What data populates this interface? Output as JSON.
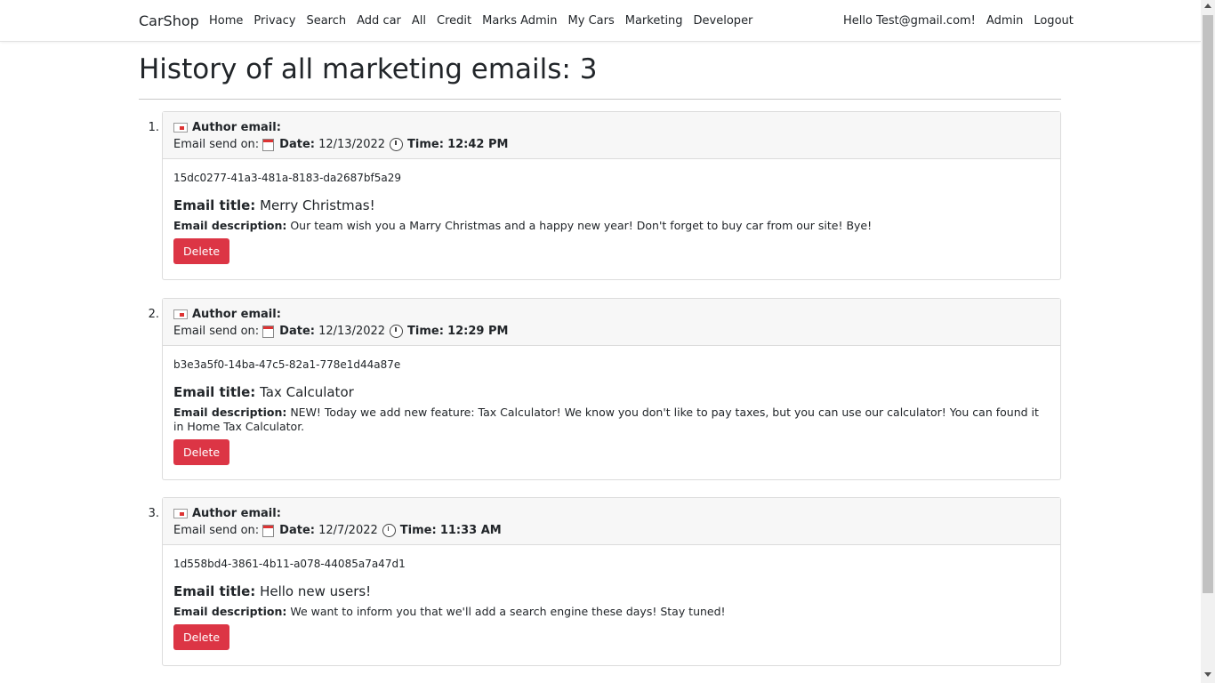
{
  "nav": {
    "brand": "CarShop",
    "links": [
      "Home",
      "Privacy",
      "Search",
      "Add car",
      "All",
      "Credit",
      "Marks Admin",
      "My Cars",
      "Marketing",
      "Developer"
    ],
    "greeting": "Hello Test@gmail.com!",
    "admin": "Admin",
    "logout": "Logout"
  },
  "page": {
    "title": "History of all marketing emails: 3"
  },
  "labels": {
    "author_email": "Author email:",
    "email_send_on": "Email send on:",
    "date": "Date:",
    "time": "Time:",
    "email_title": "Email title:",
    "email_description": "Email description:",
    "delete": "Delete"
  },
  "emails": [
    {
      "number": "1.",
      "date": "12/13/2022",
      "time": "12:42 PM",
      "id": "15dc0277-41a3-481a-8183-da2687bf5a29",
      "title": "Merry Christmas!",
      "description": "Our team wish you a Marry Christmas and a happy new year! Don't forget to buy car from our site! Bye!"
    },
    {
      "number": "2.",
      "date": "12/13/2022",
      "time": "12:29 PM",
      "id": "b3e3a5f0-14ba-47c5-82a1-778e1d44a87e",
      "title": "Tax Calculator",
      "description": "NEW! Today we add new feature: Tax Calculator! We know you don't like to pay taxes, but you can use our calculator! You can found it in Home Tax Calculator."
    },
    {
      "number": "3.",
      "date": "12/7/2022",
      "time": "11:33 AM",
      "id": "1d558bd4-3861-4b11-a078-44085a7a47d1",
      "title": "Hello new users!",
      "description": "We want to inform you that we'll add a search engine these days!  Stay tuned!"
    }
  ],
  "colors": {
    "delete_button": "#dc3545",
    "header_bg": "#f7f7f7"
  }
}
